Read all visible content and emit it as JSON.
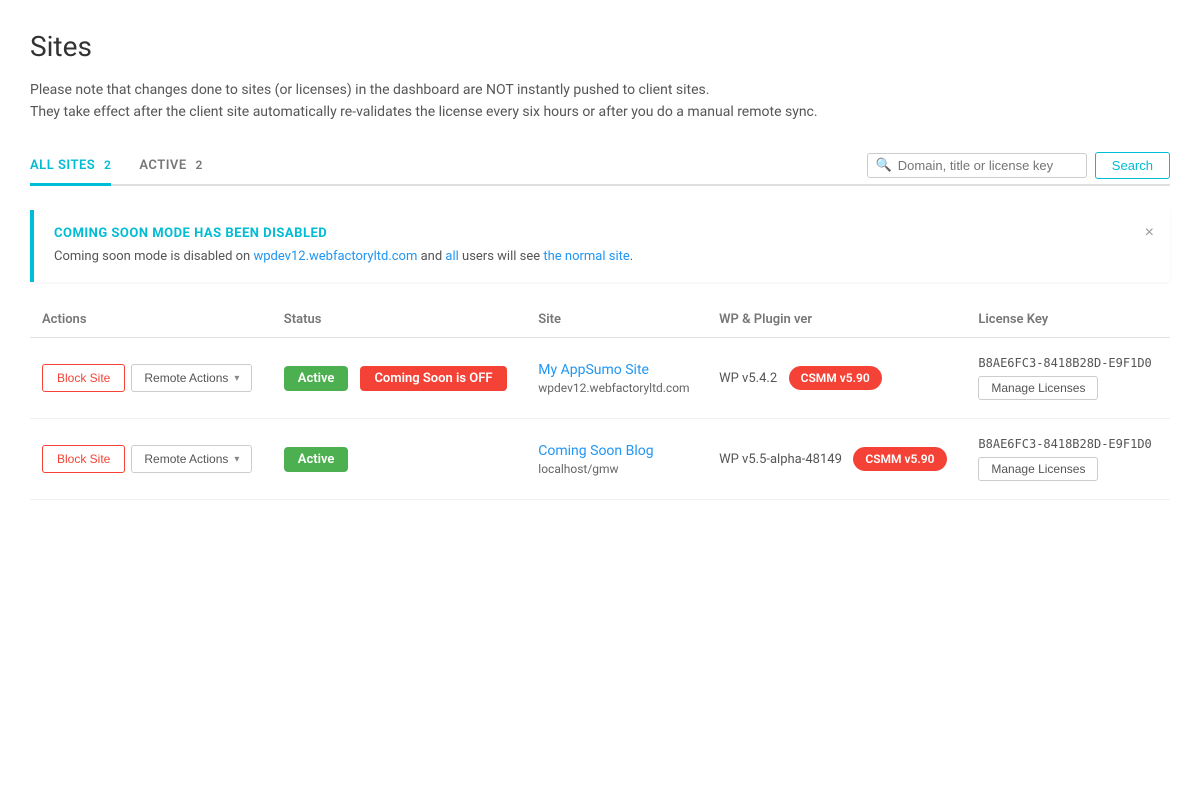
{
  "page": {
    "title": "Sites",
    "description_line1": "Please note that changes done to sites (or licenses) in the dashboard are NOT instantly pushed to client sites.",
    "description_line2": "They take effect after the client site automatically re-validates the license every six hours or after you do a manual remote sync."
  },
  "tabs": [
    {
      "id": "all-sites",
      "label": "ALL SITES",
      "count": 2,
      "active": true
    },
    {
      "id": "active",
      "label": "ACTIVE",
      "count": 2,
      "active": false
    }
  ],
  "search": {
    "placeholder": "Domain, title or license key",
    "button_label": "Search"
  },
  "alert": {
    "title": "COMING SOON MODE HAS BEEN DISABLED",
    "body_prefix": "Coming soon mode is disabled on ",
    "body_link": "wpdev12.webfactoryltd.com",
    "body_middle": " and ",
    "body_link2": "all",
    "body_suffix": " users will see ",
    "body_link3": "the normal site",
    "body_end": "."
  },
  "table": {
    "columns": [
      "Actions",
      "Status",
      "Site",
      "WP & Plugin ver",
      "License Key"
    ],
    "rows": [
      {
        "id": 1,
        "block_label": "Block Site",
        "remote_label": "Remote Actions",
        "status": "Active",
        "coming_soon": "Coming Soon is OFF",
        "site_name": "My AppSumo Site",
        "site_url": "wpdev12.webfactoryltd.com",
        "wp_ver": "WP v5.4.2",
        "csmm_ver": "CSMM v5.90",
        "license_key": "B8AE6FC3-8418B28D-E9F1D0",
        "manage_label": "Manage Licenses"
      },
      {
        "id": 2,
        "block_label": "Block Site",
        "remote_label": "Remote Actions",
        "status": "Active",
        "coming_soon": null,
        "site_name": "Coming Soon Blog",
        "site_url": "localhost/gmw",
        "wp_ver": "WP v5.5-alpha-48149",
        "csmm_ver": "CSMM v5.90",
        "license_key": "B8AE6FC3-8418B28D-E9F1D0",
        "manage_label": "Manage Licenses"
      }
    ]
  },
  "icons": {
    "search": "🔍",
    "chevron_down": "▾",
    "close": "×"
  }
}
